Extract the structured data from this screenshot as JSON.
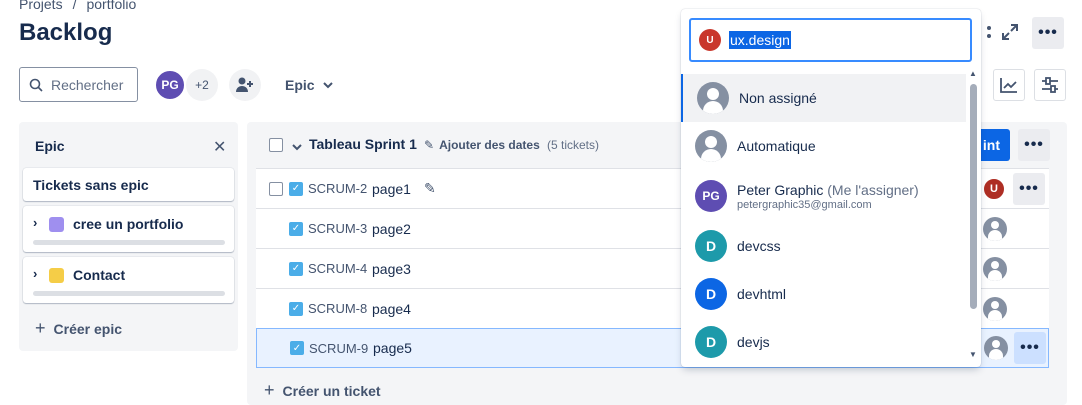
{
  "breadcrumb": {
    "root": "Projets",
    "separator": "/",
    "current": "portfolio"
  },
  "page_title": "Backlog",
  "toolbar": {
    "search_placeholder": "Rechercher",
    "avatar_initials": "PG",
    "avatar_extra": "+2",
    "epic_filter": "Epic"
  },
  "epic_panel": {
    "title": "Epic",
    "no_epic": "Tickets sans epic",
    "epics": [
      {
        "name": "cree un portfolio",
        "color": "#9f8fef"
      },
      {
        "name": "Contact",
        "color": "#f5cd47"
      }
    ],
    "create": "Créer epic"
  },
  "sprint": {
    "name": "Tableau Sprint 1",
    "add_dates": "Ajouter des dates",
    "count": "(5 tickets)",
    "start_button": "int",
    "create_ticket": "Créer un ticket",
    "tickets": [
      {
        "key": "SCRUM-2",
        "summary": "page1"
      },
      {
        "key": "SCRUM-3",
        "summary": "page2"
      },
      {
        "key": "SCRUM-4",
        "summary": "page3"
      },
      {
        "key": "SCRUM-8",
        "summary": "page4"
      },
      {
        "key": "SCRUM-9",
        "summary": "page5"
      }
    ]
  },
  "assignee_dropdown": {
    "input_avatar": "U",
    "input_value": "ux.design",
    "options": [
      {
        "label": "Non assigné"
      },
      {
        "label": "Automatique"
      },
      {
        "initials": "PG",
        "label": "Peter Graphic",
        "note": "(Me l'assigner)",
        "email": "petergraphic35@gmail.com"
      },
      {
        "initials": "D",
        "label": "devcss"
      },
      {
        "initials": "D",
        "label": "devhtml"
      },
      {
        "initials": "D",
        "label": "devjs"
      }
    ]
  },
  "row_assignee_initial": "U",
  "colors": {
    "primary": "#0c66e4",
    "avatar_pg": "#5e4db2",
    "avatar_u": "#c9372c",
    "avatar_teal": "#1d9aaa",
    "avatar_blue": "#0c66e4",
    "story": "#4bade8"
  }
}
